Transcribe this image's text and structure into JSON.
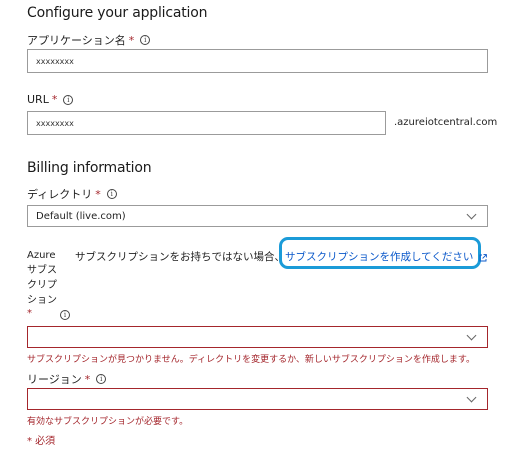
{
  "configure": {
    "title": "Configure your application",
    "app_name": {
      "label": "アプリケーション名",
      "required": "*",
      "value": "xxxxxxxx"
    },
    "url": {
      "label": "URL",
      "required": "*",
      "value": "xxxxxxxx",
      "suffix": ".azureiotcentral.com"
    }
  },
  "billing": {
    "title": "Billing information",
    "directory": {
      "label": "ディレクトリ",
      "required": "*",
      "selected": "Default (live.com)"
    },
    "subscription": {
      "label_lines": [
        "Azure",
        "サブス",
        "クリプ",
        "ション"
      ],
      "required": "*",
      "hint": "サブスクリプションをお持ちではない場合、",
      "create_link": "サブスクリプションを作成してください",
      "selected": "",
      "error": "サブスクリプションが見つかりません。ディレクトリを変更するか、新しいサブスクリプションを作成します。"
    },
    "region": {
      "label": "リージョン",
      "required": "*",
      "selected": "",
      "error": "有効なサブスクリプションが必要です。"
    },
    "required_note": "* 必須"
  },
  "icons": {
    "info": "info-icon",
    "external": "external-link-icon",
    "chevron": "chevron-down-icon"
  },
  "colors": {
    "error": "#a4262c",
    "link": "#0a58ca",
    "highlight": "#1b9bd8"
  }
}
